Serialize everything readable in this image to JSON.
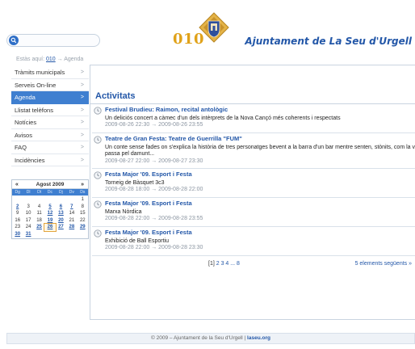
{
  "header": {
    "logo_number": "010",
    "site_title": "Ajuntament de La Seu d'Urgell",
    "search": {
      "placeholder": "",
      "value": ""
    }
  },
  "breadcrumb": {
    "prefix": "Estàs aquí:",
    "link": "010",
    "sep": "→",
    "current": "Agenda"
  },
  "sidebar": {
    "items": [
      {
        "label": "Tràmits municipals",
        "active": false
      },
      {
        "label": "Serveis On-line",
        "active": false
      },
      {
        "label": "Agenda",
        "active": true
      },
      {
        "label": "Llistat telèfons",
        "active": false
      },
      {
        "label": "Notícies",
        "active": false
      },
      {
        "label": "Avisos",
        "active": false
      },
      {
        "label": "FAQ",
        "active": false
      },
      {
        "label": "Incidències",
        "active": false
      }
    ],
    "arrow": ">"
  },
  "calendar": {
    "title": "Agost 2009",
    "prev": "«",
    "next": "»",
    "weekdays": [
      "Dg",
      "Dl",
      "Dt",
      "Dc",
      "Dj",
      "Dv",
      "Ds"
    ],
    "weeks": [
      [
        "",
        "",
        "",
        "",
        "",
        "",
        "1"
      ],
      [
        "2",
        "3",
        "4",
        "5",
        "6",
        "7",
        "8"
      ],
      [
        "9",
        "10",
        "11",
        "12",
        "13",
        "14",
        "15"
      ],
      [
        "16",
        "17",
        "18",
        "19",
        "20",
        "21",
        "22"
      ],
      [
        "23",
        "24",
        "25",
        "26",
        "27",
        "28",
        "29"
      ],
      [
        "30",
        "31",
        "",
        "",
        "",
        "",
        ""
      ]
    ],
    "linked_days": [
      "2",
      "5",
      "6",
      "7",
      "12",
      "13",
      "19",
      "20",
      "25",
      "26",
      "27",
      "28",
      "29",
      "30",
      "31"
    ],
    "today": "26"
  },
  "main": {
    "title": "Activitats",
    "events": [
      {
        "title": "Festival Brudieu: Raimon, recital antològic",
        "desc": "Un deliciós concert a càmec d'un dels intèrprets de la Nova Cançó més coherents i respectats",
        "desc2": "",
        "date": "2009-08-26 22:30 → 2009-08-26 23:55"
      },
      {
        "title": "Teatre de Gran Festa: Teatre de Guerrilla \"FUM\"",
        "desc": "Un conte sense fades on s'explica la història de tres personatges bevent a la barra d'un bar mentre senten, stònits, com la vida va",
        "desc2": "passa pel damunt...",
        "date": "2009-08-27 22:00 → 2009-08-27 23:30"
      },
      {
        "title": "Festa Major '09. Esport i Festa",
        "desc": "Torneig de Bàsquet 3c3",
        "desc2": "",
        "date": "2009-08-28 18:00 → 2009-08-28 22:00"
      },
      {
        "title": "Festa Major '09. Esport i Festa",
        "desc": "Marxa Nòrdica",
        "desc2": "",
        "date": "2009-08-28 22:00 → 2009-08-28 23:55"
      },
      {
        "title": "Festa Major '09. Esport i Festa",
        "desc": "Exhibició de Ball Esportiu",
        "desc2": "",
        "date": "2009-08-28 22:00 → 2009-08-28 23:30"
      }
    ],
    "pager": {
      "current": "[1]",
      "pages": "2 3 4 ... 8"
    },
    "next_link": "5 elements següents »"
  },
  "footer": {
    "text": "© 2009 – Ajuntament de la Seu d'Urgell | ",
    "brand": "laseu.org"
  },
  "colors": {
    "accent": "#3f7fd0",
    "link": "#2357a8",
    "logo": "#e0a21a"
  }
}
